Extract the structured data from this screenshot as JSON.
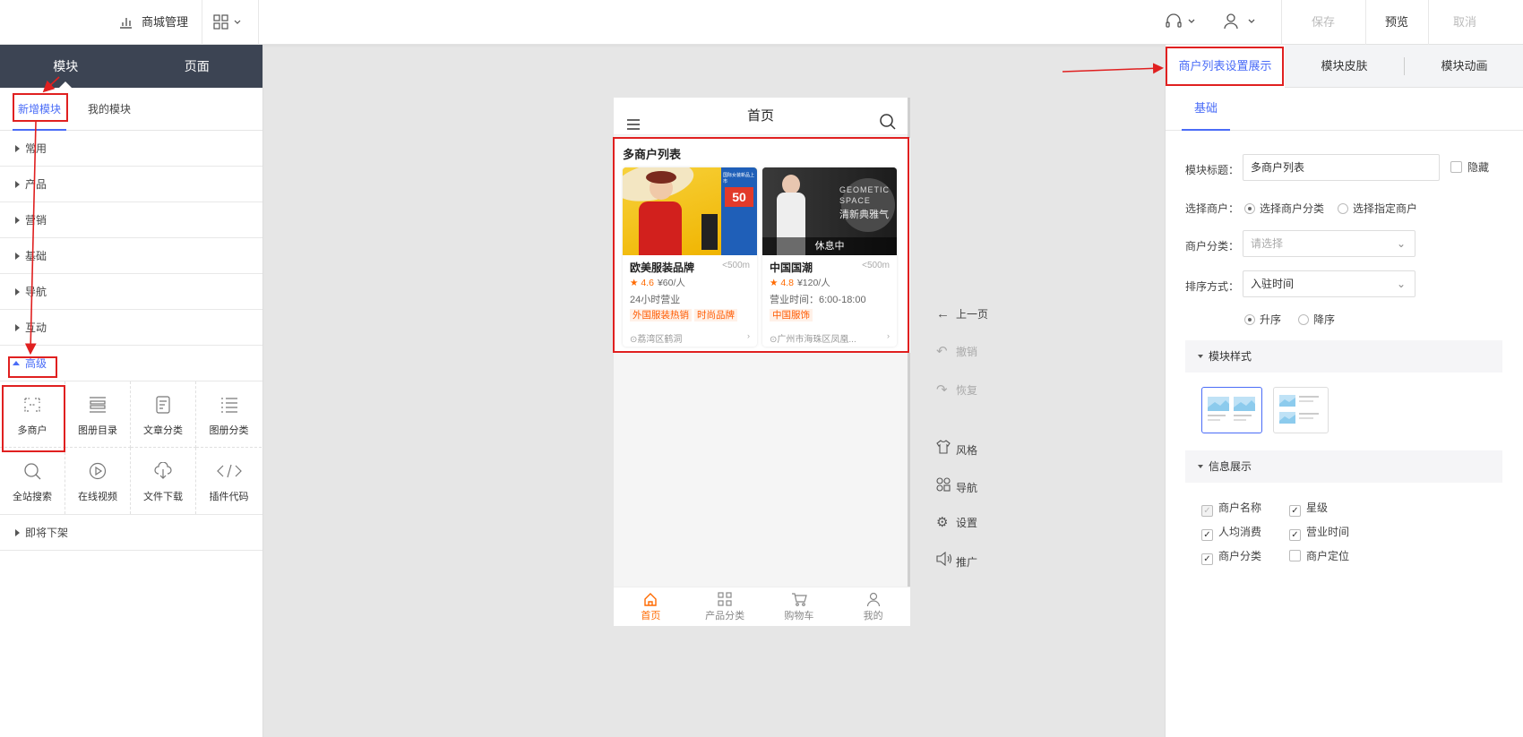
{
  "topbar": {
    "mall_manage": "商城管理",
    "save": "保存",
    "preview": "预览",
    "cancel": "取消"
  },
  "left": {
    "tabs": [
      "模块",
      "页面"
    ],
    "subtabs": [
      "新增模块",
      "我的模块"
    ],
    "categories": [
      "常用",
      "产品",
      "营销",
      "基础",
      "导航",
      "互动"
    ],
    "advanced": "高级",
    "modules": [
      {
        "label": "多商户",
        "icon": "multi-merchant-icon"
      },
      {
        "label": "图册目录",
        "icon": "album-catalog-icon"
      },
      {
        "label": "文章分类",
        "icon": "article-category-icon"
      },
      {
        "label": "图册分类",
        "icon": "album-category-icon"
      },
      {
        "label": "全站搜索",
        "icon": "search-icon"
      },
      {
        "label": "在线视频",
        "icon": "video-play-icon"
      },
      {
        "label": "文件下载",
        "icon": "cloud-download-icon"
      },
      {
        "label": "插件代码",
        "icon": "code-icon"
      }
    ],
    "footer_category": "即将下架"
  },
  "phone": {
    "title": "首页",
    "section_title": "多商户列表",
    "cards": [
      {
        "name": "欧美服装品牌",
        "distance": "<500m",
        "rating": "4.6",
        "price": "¥60/人",
        "hours": "24小时营业",
        "tags": [
          "外国服装热销",
          "时尚品牌"
        ],
        "address": "荔湾区鹤洞",
        "image_badge": "50",
        "image_text": "国际女装新品上市"
      },
      {
        "name": "中国国潮",
        "distance": "<500m",
        "rating": "4.8",
        "price": "¥120/人",
        "hours": "营业时间：6:00-18:00",
        "tags": [
          "中国服饰"
        ],
        "address": "广州市海珠区凤凰...",
        "image_overlay": "休息中",
        "image_text_1": "GEOMETIC",
        "image_text_2": "SPACE",
        "image_text_3": "清新典雅气"
      }
    ],
    "nav": [
      {
        "label": "首页",
        "icon": "home-icon"
      },
      {
        "label": "产品分类",
        "icon": "grid-icon"
      },
      {
        "label": "购物车",
        "icon": "cart-icon"
      },
      {
        "label": "我的",
        "icon": "user-icon"
      }
    ]
  },
  "tools": [
    {
      "label": "上一页",
      "icon": "arrow-left-icon"
    },
    {
      "label": "撤销",
      "icon": "undo-icon"
    },
    {
      "label": "恢复",
      "icon": "redo-icon"
    },
    {
      "label": "风格",
      "icon": "shirt-icon"
    },
    {
      "label": "导航",
      "icon": "nav-icon"
    },
    {
      "label": "设置",
      "icon": "gear-icon"
    },
    {
      "label": "推广",
      "icon": "speaker-icon"
    }
  ],
  "right": {
    "tabs": [
      "商户列表设置展示",
      "模块皮肤",
      "模块动画"
    ],
    "subtab": "基础",
    "module_title_label": "模块标题：",
    "module_title_value": "多商户列表",
    "hide": "隐藏",
    "select_merchant_label": "选择商户：",
    "select_by_category": "选择商户分类",
    "select_specific": "选择指定商户",
    "merchant_category_label": "商户分类：",
    "merchant_category_placeholder": "请选择",
    "sort_label": "排序方式：",
    "sort_value": "入驻时间",
    "asc": "升序",
    "desc": "降序",
    "module_style": "模块样式",
    "info_display": "信息展示",
    "info_items": [
      {
        "label": "商户名称",
        "checked": true
      },
      {
        "label": "星级",
        "checked": true
      },
      {
        "label": "人均消费",
        "checked": true
      },
      {
        "label": "营业时间",
        "checked": true
      },
      {
        "label": "商户分类",
        "checked": true
      },
      {
        "label": "商户定位",
        "checked": false
      }
    ]
  },
  "colors": {
    "accent": "#4a6cf7",
    "orange": "#ff6a00",
    "dark_header": "#3c4453",
    "highlight_red": "#e02020"
  }
}
